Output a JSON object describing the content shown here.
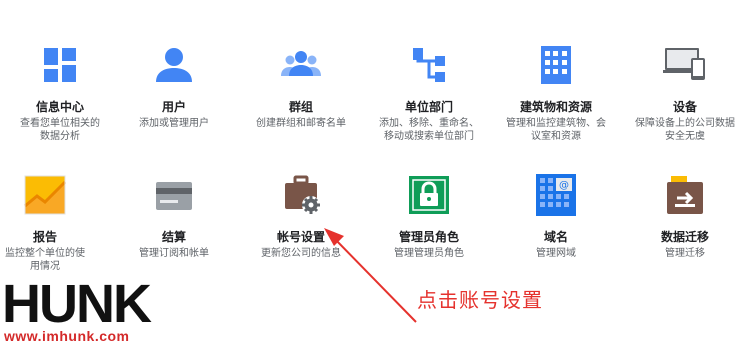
{
  "tiles": [
    {
      "title": "信息中心",
      "desc": "查看您单位相关的数据分析",
      "icon": "dashboard-icon"
    },
    {
      "title": "用户",
      "desc": "添加或管理用户",
      "icon": "user-icon"
    },
    {
      "title": "群组",
      "desc": "创建群组和邮寄名单",
      "icon": "group-icon"
    },
    {
      "title": "单位部门",
      "desc": "添加、移除、重命名、移动或搜索单位部门",
      "icon": "org-tree-icon"
    },
    {
      "title": "建筑物和资源",
      "desc": "管理和监控建筑物、会议室和资源",
      "icon": "building-icon"
    },
    {
      "title": "设备",
      "desc": "保障设备上的公司数据安全无虞",
      "icon": "devices-icon"
    },
    {
      "title": "报告",
      "desc": "监控整个单位的使用情况",
      "icon": "report-chart-icon"
    },
    {
      "title": "结算",
      "desc": "管理订阅和帐单",
      "icon": "billing-card-icon"
    },
    {
      "title": "帐号设置",
      "desc": "更新您公司的信息",
      "icon": "account-settings-icon"
    },
    {
      "title": "管理员角色",
      "desc": "管理管理员角色",
      "icon": "admin-lock-icon"
    },
    {
      "title": "域名",
      "desc": "管理网域",
      "icon": "domain-icon"
    },
    {
      "title": "数据迁移",
      "desc": "管理迁移",
      "icon": "data-migration-icon"
    }
  ],
  "annotation": "点击账号设置",
  "watermark": {
    "word": "HUNK",
    "url": "www.imhunk.com"
  },
  "colors": {
    "blue": "#4285f4",
    "annot_red": "#e5322d",
    "green": "#0f9d58",
    "brown": "#795548"
  }
}
